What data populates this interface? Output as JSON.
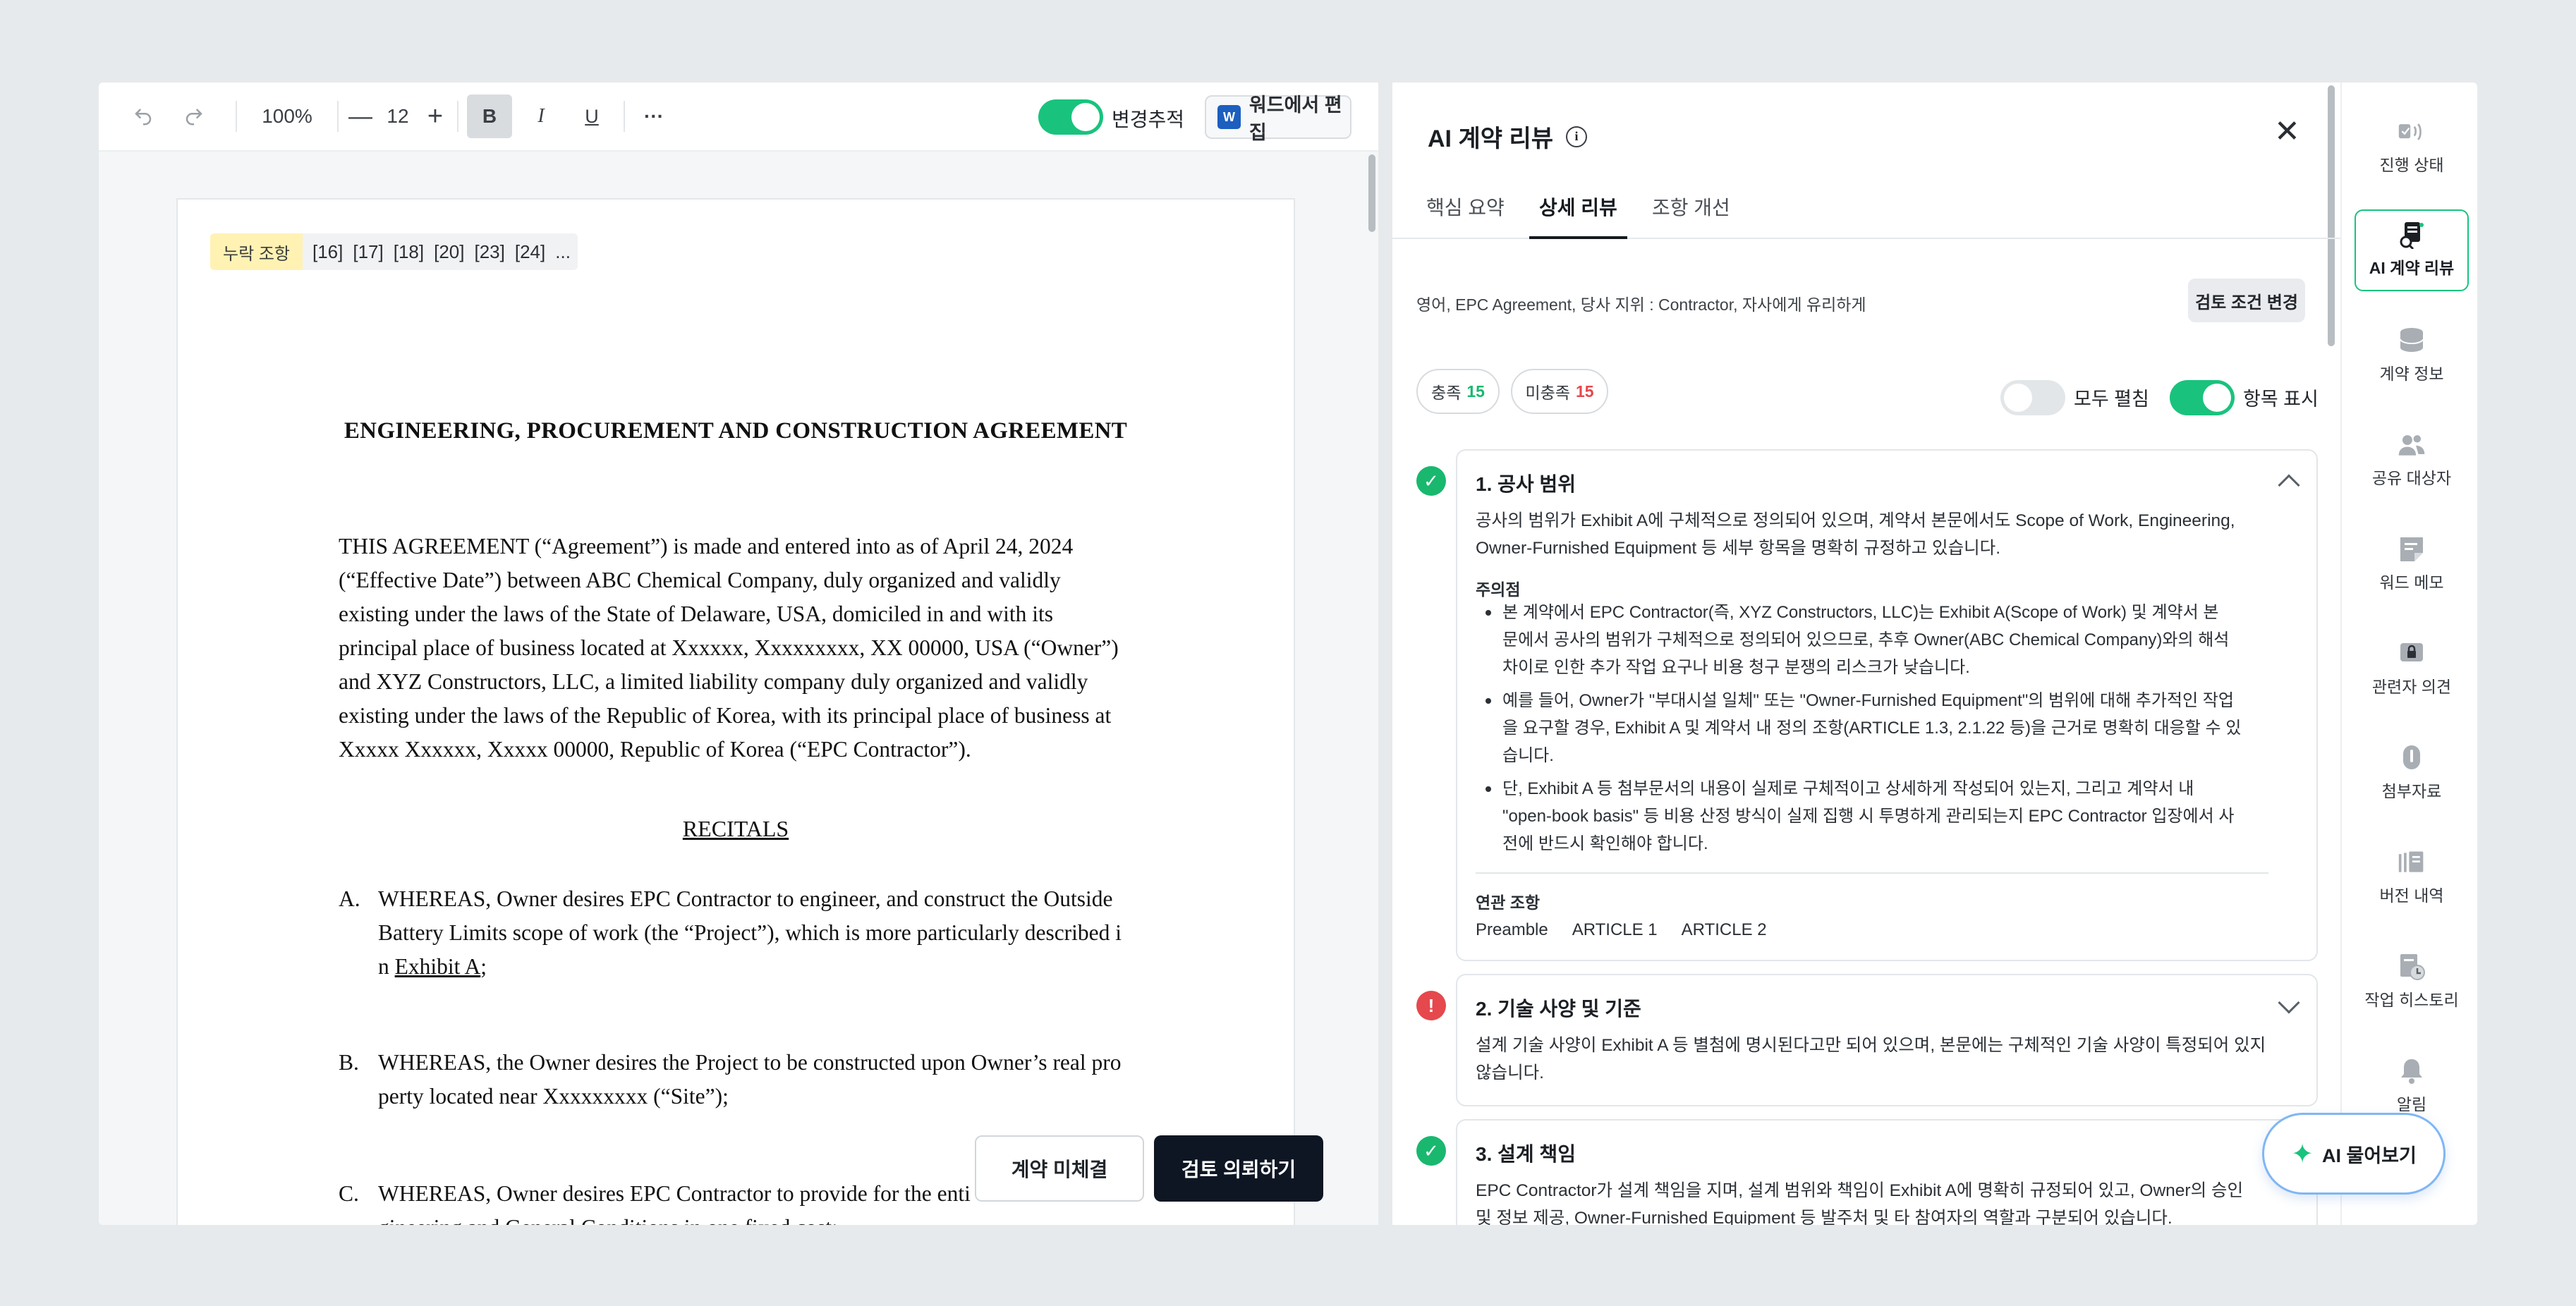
{
  "toolbar": {
    "zoom": "100%",
    "font_size": "12",
    "bold": "B",
    "italic": "I",
    "underline": "U",
    "more": "···",
    "track_changes_label": "변경추적",
    "word_edit_label": "워드에서 편집",
    "word_logo": "W"
  },
  "document": {
    "missing_tag": "누락 조항",
    "missing_refs": [
      "[16]",
      "[17]",
      "[18]",
      "[20]",
      "[23]",
      "[24]",
      "..."
    ],
    "title": "ENGINEERING, PROCUREMENT AND CONSTRUCTION AGREEMENT",
    "intro_lines": [
      "THIS AGREEMENT (“Agreement”) is made and entered into as of April 24, 2024",
      "(“Effective Date”) between ABC Chemical Company, duly organized and validly",
      "existing under the laws of the State of Delaware, USA, domiciled in and with its",
      "principal place of business located at Xxxxxx, Xxxxxxxxx, XX 00000, USA (“Owner”)",
      "and XYZ Constructors, LLC, a limited liability company duly organized and validly",
      "existing under the laws of the Republic of Korea, with its principal place of business at",
      "Xxxxx Xxxxxx, Xxxxx 00000, Republic of Korea (“EPC Contractor”)."
    ],
    "recitals_heading": "RECITALS",
    "recital_a": {
      "letter": "A.",
      "line1": "WHEREAS, Owner desires EPC Contractor to engineer, and construct the Outside",
      "line2": "Battery Limits scope of work (the “Project”), which is more particularly described i",
      "line3_prefix": "n ",
      "line3_link": "Exhibit A",
      "line3_suffix": ";"
    },
    "recital_b": {
      "letter": "B.",
      "line1": "WHEREAS, the Owner desires the Project to be constructed upon Owner’s real pro",
      "line2": "perty located near Xxxxxxxxx (“Site”);"
    },
    "recital_c": {
      "letter": "C.",
      "line1": "WHEREAS, Owner desires EPC Contractor to provide for the enti",
      "line2": "gineering and General Conditions in one fixed cost;"
    }
  },
  "actions": {
    "not_signed": "계약 미체결",
    "request_review": "검토 의뢰하기"
  },
  "review": {
    "title": "AI 계약 리뷰",
    "tabs": [
      "핵심 요약",
      "상세 리뷰",
      "조항 개선"
    ],
    "active_tab": 1,
    "conditions": "영어, EPC Agreement, 당사 지위 : Contractor, 자사에게 유리하게",
    "change_conditions": "검토 조건 변경",
    "met_label": "충족",
    "met_count": "15",
    "unmet_label": "미충족",
    "unmet_count": "15",
    "expand_all": "모두 펼침",
    "show_items": "항목 표시",
    "items": [
      {
        "title": "1. 공사 범위",
        "desc_lines": [
          "공사의 범위가 Exhibit A에 구체적으로 정의되어 있으며, 계약서 본문에서도 Scope of Work, Engineering,",
          "Owner-Furnished Equipment 등 세부 항목을 명확히 규정하고 있습니다."
        ],
        "note_head": "주의점",
        "notes": [
          [
            "본 계약에서 EPC Contractor(즉, XYZ Constructors, LLC)는 Exhibit A(Scope of Work) 및 계약서 본",
            "문에서 공사의 범위가 구체적으로 정의되어 있으므로, 추후 Owner(ABC Chemical Company)와의 해석",
            "차이로 인한 추가 작업 요구나 비용 청구 분쟁의 리스크가 낮습니다."
          ],
          [
            "예를 들어, Owner가 \"부대시설 일체\" 또는 \"Owner-Furnished Equipment\"의 범위에 대해 추가적인 작업",
            "을 요구할 경우, Exhibit A 및 계약서 내 정의 조항(ARTICLE 1.3, 2.1.22 등)을 근거로 명확히 대응할 수 있",
            "습니다."
          ],
          [
            "단, Exhibit A 등 첨부문서의 내용이 실제로 구체적이고 상세하게 작성되어 있는지, 그리고 계약서 내",
            "\"open-book basis\" 등 비용 산정 방식이 실제 집행 시 투명하게 관리되는지 EPC Contractor 입장에서 사",
            "전에 반드시 확인해야 합니다."
          ]
        ],
        "related_head": "연관 조항",
        "related": [
          "Preamble",
          "ARTICLE 1",
          "ARTICLE 2"
        ]
      },
      {
        "title": "2. 기술 사양 및 기준",
        "desc_lines": [
          "설계 기술 사양이 Exhibit A 등 별첨에 명시된다고만 되어 있으며, 본문에는 구체적인 기술 사양이 특정되어 있지",
          "않습니다."
        ]
      },
      {
        "title": "3. 설계 책임",
        "desc_lines": [
          "EPC Contractor가 설계 책임을 지며, 설계 범위와 책임이 Exhibit A에 명확히 규정되어 있고, Owner의 승인",
          "및 정보 제공, Owner-Furnished Equipment 등 발주처 및 타 참여자의 역할과 구분되어 있습니다."
        ]
      }
    ]
  },
  "sidebar": [
    {
      "label": "진행 상태",
      "icon": "progress-icon"
    },
    {
      "label": "AI 계약 리뷰",
      "icon": "ai-review-icon"
    },
    {
      "label": "계약 정보",
      "icon": "database-icon"
    },
    {
      "label": "공유 대상자",
      "icon": "users-icon"
    },
    {
      "label": "워드 메모",
      "icon": "memo-icon"
    },
    {
      "label": "관련자 의견",
      "icon": "lock-comment-icon"
    },
    {
      "label": "첨부자료",
      "icon": "paperclip-icon"
    },
    {
      "label": "버전 내역",
      "icon": "versions-icon"
    },
    {
      "label": "작업 히스토리",
      "icon": "history-icon"
    },
    {
      "label": "알림",
      "icon": "bell-icon"
    }
  ],
  "ai_ask": "AI 물어보기",
  "colors": {
    "accent_green": "#19c37d",
    "status_ok": "#19b86e",
    "status_bad": "#e5484d",
    "dark_button": "#0e1624",
    "missing_tag_bg": "#fff2b3"
  }
}
